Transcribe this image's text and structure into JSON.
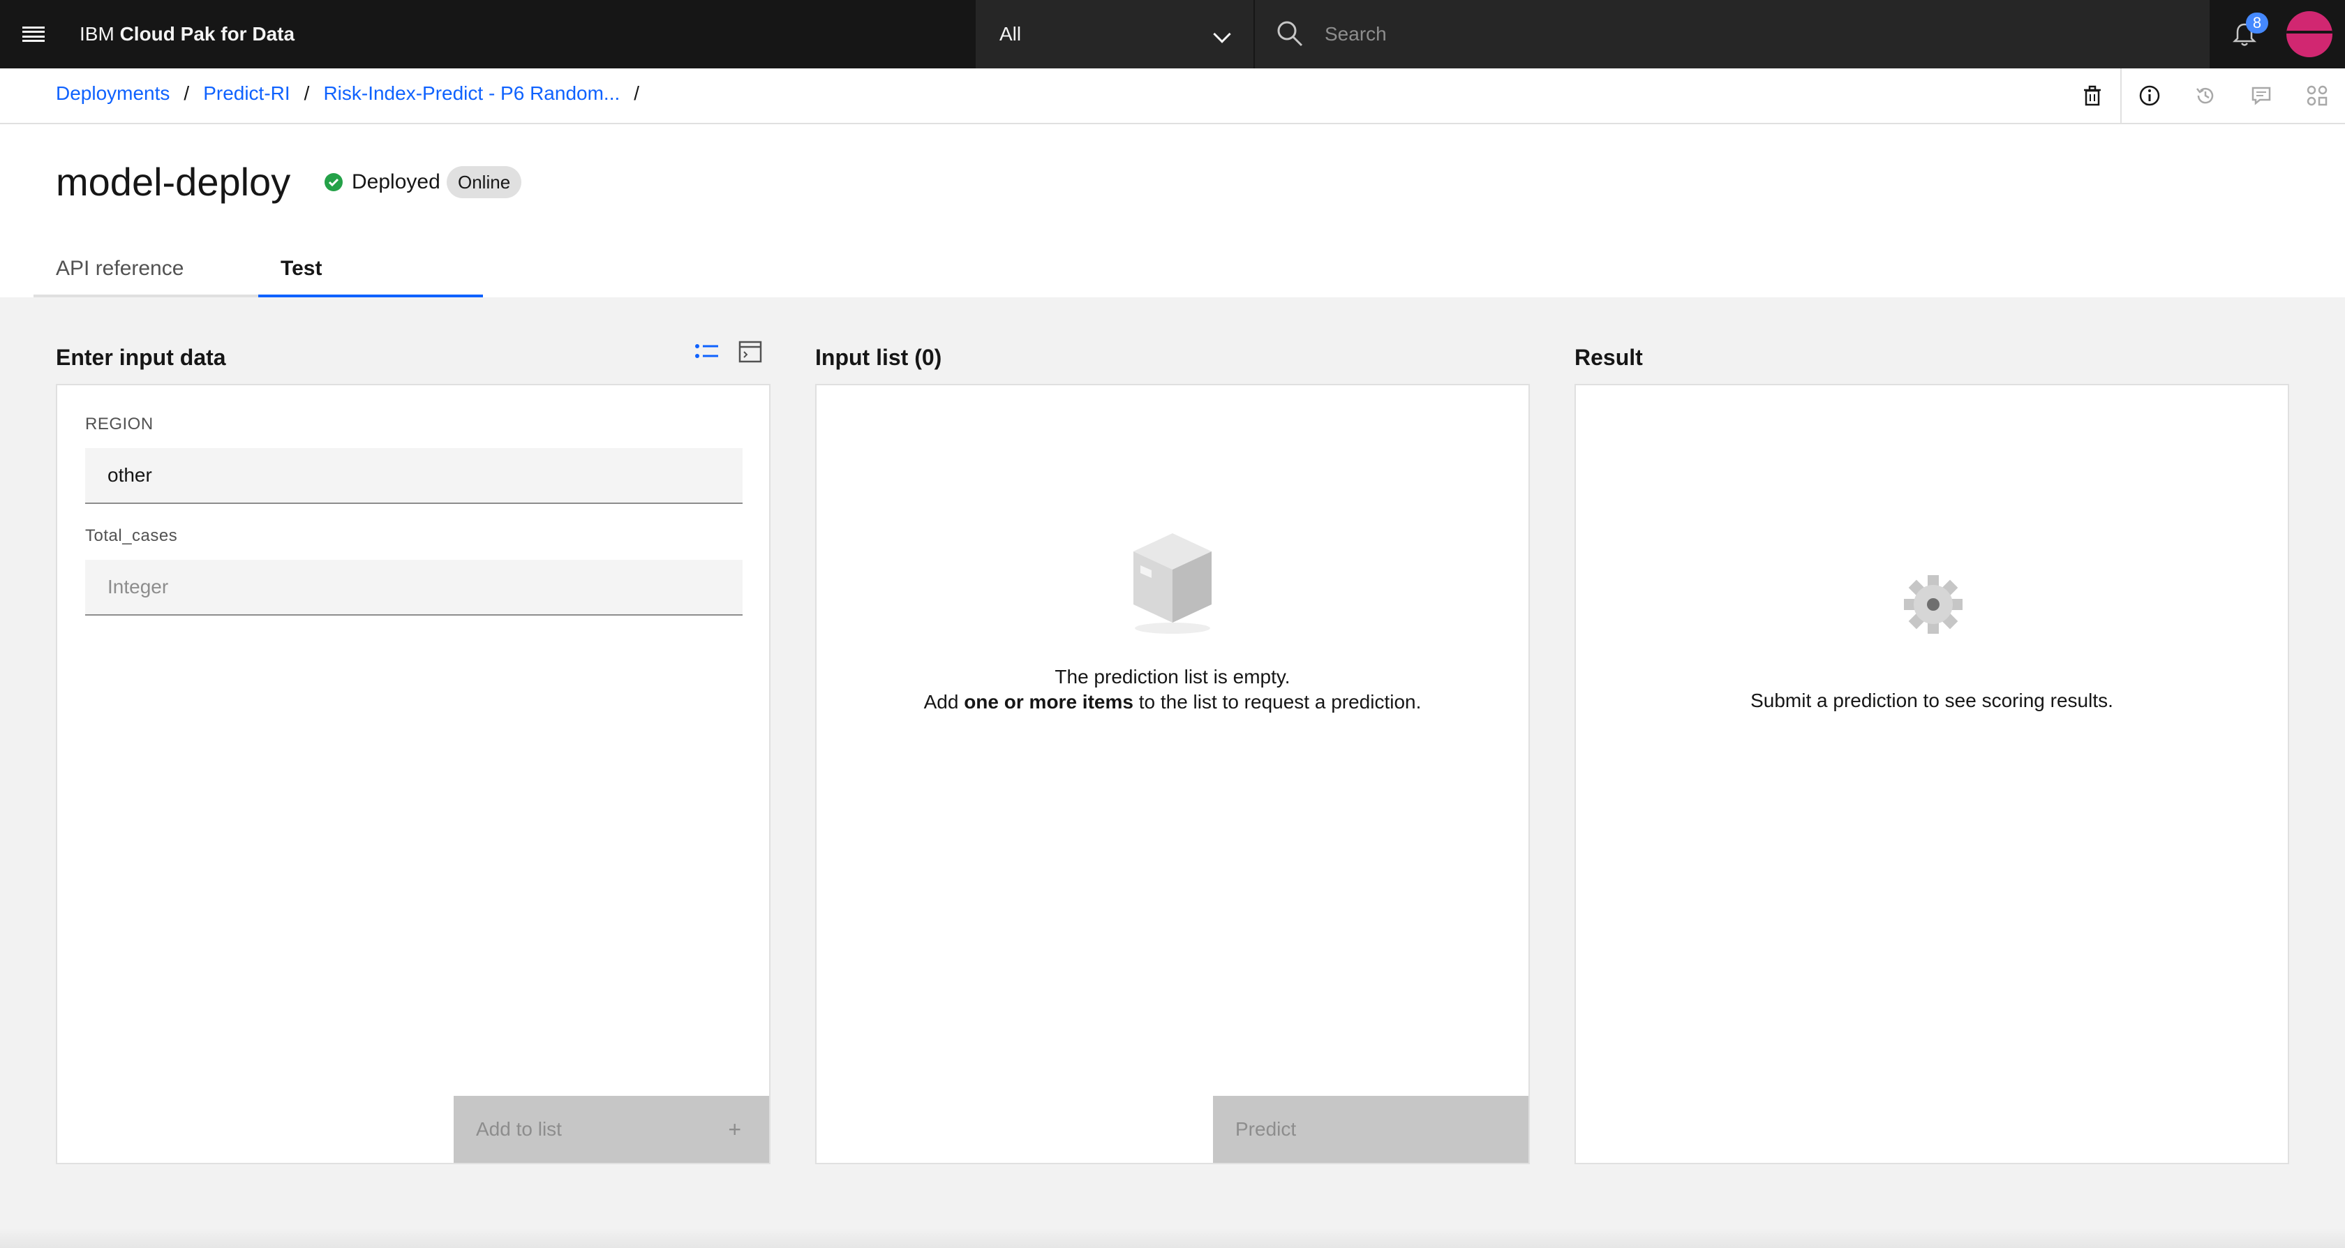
{
  "header": {
    "brand_prefix": "IBM",
    "brand_name": "Cloud Pak for Data",
    "scope_value": "All",
    "search_placeholder": "Search",
    "notification_count": "8"
  },
  "breadcrumb": {
    "items": [
      "Deployments",
      "Predict-RI",
      "Risk-Index-Predict - P6 Random..."
    ],
    "separator": "/"
  },
  "page": {
    "title": "model-deploy",
    "status": "Deployed",
    "status_color": "#24a148",
    "tag": "Online",
    "tabs": [
      {
        "label": "API reference",
        "active": false
      },
      {
        "label": "Test",
        "active": true
      }
    ]
  },
  "input_panel": {
    "title": "Enter input data",
    "fields": [
      {
        "label": "REGION",
        "value": "other",
        "placeholder": ""
      },
      {
        "label": "Total_cases",
        "value": "",
        "placeholder": "Integer"
      }
    ],
    "add_button": "Add to list",
    "add_icon": "+"
  },
  "list_panel": {
    "title": "Input list (0)",
    "empty_line1": "The prediction list is empty.",
    "empty_line2_pre": "Add ",
    "empty_line2_bold": "one or more items",
    "empty_line2_post": " to the list to request a prediction.",
    "predict_button": "Predict"
  },
  "result_panel": {
    "title": "Result",
    "empty_text": "Submit a prediction to see scoring results."
  },
  "colors": {
    "accent": "#0f62fe",
    "header_bg": "#161616",
    "avatar": "#d12771"
  }
}
